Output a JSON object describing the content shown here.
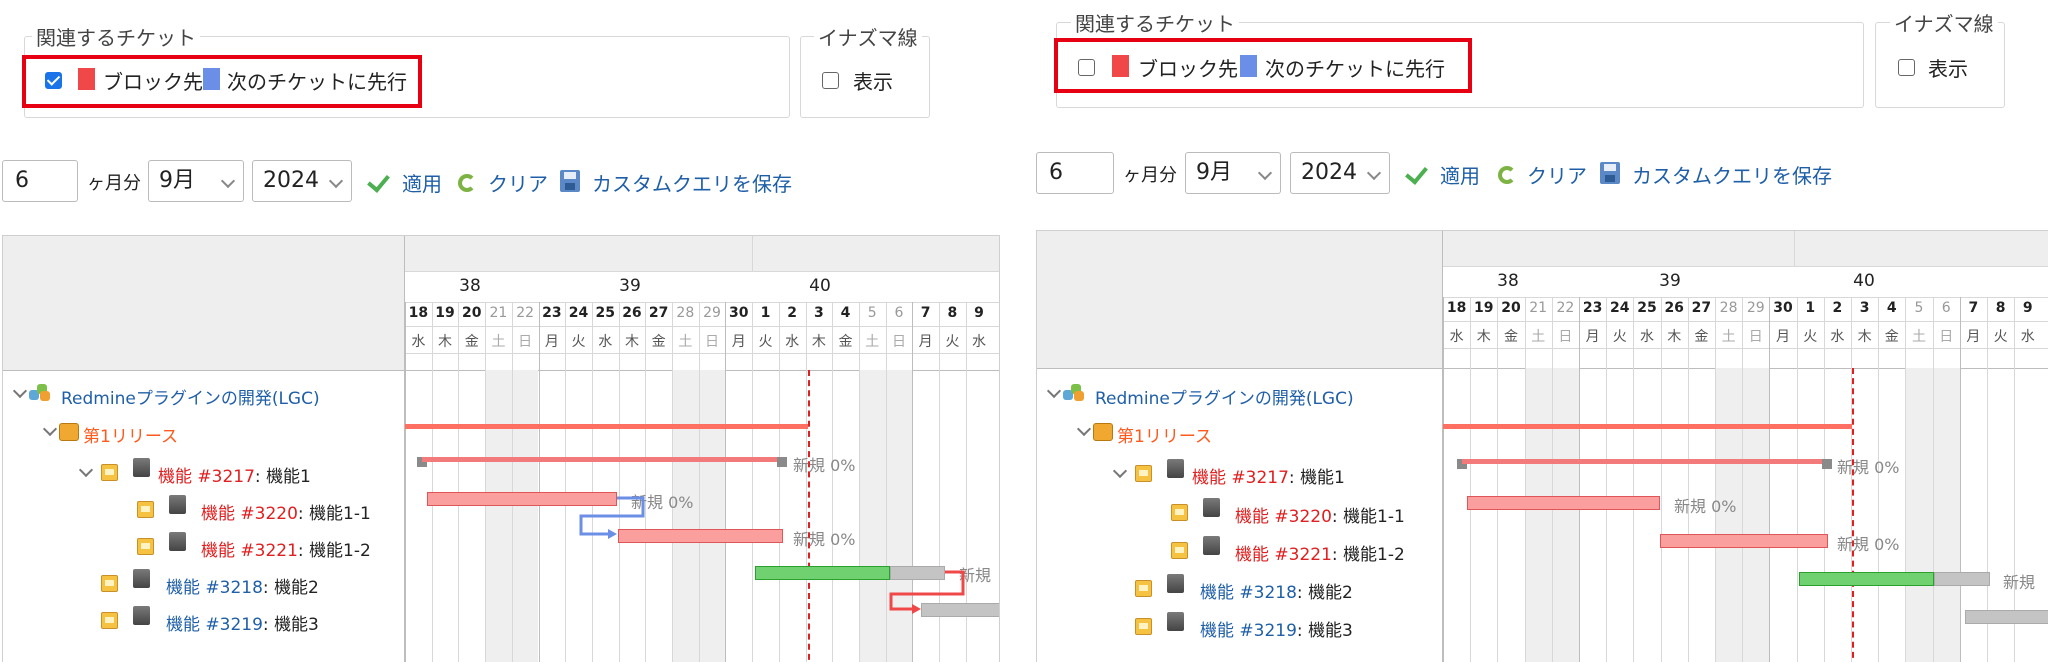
{
  "relations": {
    "legend": "関連するチケット",
    "block_label": "ブロック先",
    "precede_label": "次のチケットに先行",
    "block_color": "#f04848",
    "precede_color": "#6b8fe6"
  },
  "lightning": {
    "legend": "イナズマ線",
    "show_label": "表示"
  },
  "toolbar": {
    "months_value": "6",
    "months_suffix": "ヶ月分",
    "month_value": "9月",
    "year_value": "2024",
    "apply_label": "適用",
    "clear_label": "クリア",
    "save_label": "カスタムクエリを保存"
  },
  "gantt": {
    "weeks": [
      "38",
      "39",
      "40"
    ],
    "days": [
      "18",
      "19",
      "20",
      "21",
      "22",
      "23",
      "24",
      "25",
      "26",
      "27",
      "28",
      "29",
      "30",
      "1",
      "2",
      "3",
      "4",
      "5",
      "6",
      "7",
      "8",
      "9"
    ],
    "weekdays": [
      "水",
      "木",
      "金",
      "土",
      "日",
      "月",
      "火",
      "水",
      "木",
      "金",
      "土",
      "日",
      "月",
      "火",
      "水",
      "木",
      "金",
      "土",
      "日",
      "月",
      "火",
      "水"
    ],
    "project": "Redmineプラグインの開発(LGC)",
    "version": "第1リリース",
    "issues": [
      {
        "tracker_id": "機能 #3217",
        "subject": "機能1",
        "status": "新規 0%"
      },
      {
        "tracker_id": "機能 #3220",
        "subject": "機能1-1",
        "status": "新規 0%"
      },
      {
        "tracker_id": "機能 #3221",
        "subject": "機能1-2",
        "status": "新規 0%"
      },
      {
        "tracker_id": "機能 #3218",
        "subject": "機能2",
        "status": "新規"
      },
      {
        "tracker_id": "機能 #3219",
        "subject": "機能3",
        "status": ""
      }
    ],
    "status_right": "新規"
  },
  "panels": [
    {
      "name": "left",
      "block_checked": true,
      "show_arrows": true
    },
    {
      "name": "right",
      "block_checked": false,
      "show_arrows": false
    }
  ]
}
